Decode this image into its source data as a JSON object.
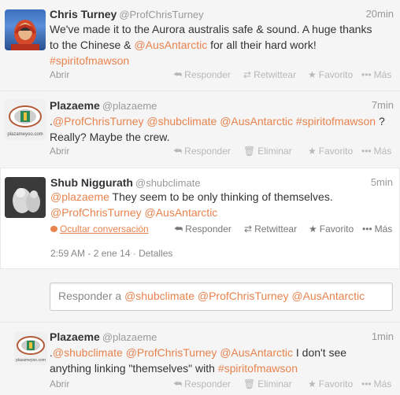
{
  "tweets": [
    {
      "name": "Chris Turney",
      "handle": "@ProfChrisTurney",
      "time": "20min",
      "text_parts": [
        {
          "t": "We've made it to the Aurora australis safe & sound. A huge thanks"
        },
        {
          "t": "to the Chinese & "
        },
        {
          "t": "@AusAntarctic",
          "link": true
        },
        {
          "t": " for all their hard work!"
        },
        {
          "t": "#spiritofmawson",
          "link": true
        }
      ],
      "expand": "Abrir",
      "actions": [
        "Responder",
        "Retwittear",
        "Favorito",
        "Más"
      ],
      "avatar_icon": "person-avatar-icon"
    },
    {
      "name": "Plazaeme",
      "handle": "@plazaeme",
      "time": "7min",
      "expand": "Abrir",
      "actions": [
        "Responder",
        "Eliminar",
        "Favorito",
        "Más"
      ],
      "avatar_icon": "plazaeme-logo-icon"
    },
    {
      "name": "Shub Niggurath",
      "handle": "@shubclimate",
      "time": "5min",
      "hide": "Ocultar conversación",
      "actions": [
        "Responder",
        "Retwittear",
        "Favorito",
        "Más"
      ],
      "meta": "2:59 AM - 2 ene 14 · Detalles",
      "avatar_icon": "shub-avatar-icon"
    },
    {
      "name": "Plazaeme",
      "handle": "@plazaeme",
      "time": "1min",
      "expand": "Abrir",
      "actions": [
        "Responder",
        "Eliminar",
        "Favorito",
        "Más"
      ],
      "avatar_icon": "plazaeme-logo-icon"
    }
  ],
  "reply": {
    "prefix": "Responder a ",
    "mentions": "@shubclimate @ProfChrisTurney @AusAntarctic"
  },
  "avatar_caption": "plazameyoo.com",
  "text": {
    "t2_line1": [
      ".",
      "@ProfChrisTurney",
      " ",
      "@shubclimate",
      " ",
      "@AusAntarctic",
      " ",
      "#spiritofmawson",
      " ?"
    ],
    "t2_line2": "Really? Maybe the crew.",
    "t3_line1": [
      "@plazaeme",
      " They seem to be only thinking of themselves."
    ],
    "t3_line2": [
      "@ProfChrisTurney",
      " ",
      "@AusAntarctic"
    ],
    "t4_line1": [
      ".",
      "@shubclimate",
      " ",
      "@ProfChrisTurney",
      " ",
      "@AusAntarctic",
      " I don't see"
    ],
    "t4_line2": [
      "anything linking \"themselves\" with ",
      "#spiritofmawson"
    ]
  },
  "colors": {
    "link": "#e8834e",
    "background": "#f5f5f5",
    "selected_background": "#ffffff"
  }
}
